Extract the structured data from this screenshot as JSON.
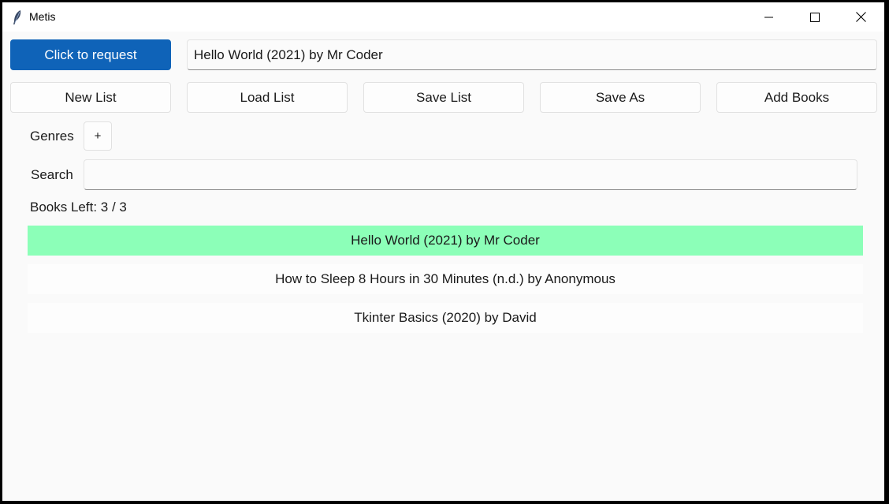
{
  "window": {
    "title": "Metis"
  },
  "titlebar": {
    "minimize_icon": "minimize-icon",
    "maximize_icon": "maximize-icon",
    "close_icon": "close-icon",
    "app_icon": "feather-icon"
  },
  "request": {
    "button_label": "Click to request",
    "field_value": "Hello World (2021) by Mr Coder"
  },
  "toolbar": {
    "buttons": [
      "New List",
      "Load List",
      "Save List",
      "Save As",
      "Add Books"
    ]
  },
  "genres": {
    "label": "Genres",
    "add_label": "+"
  },
  "search": {
    "label": "Search",
    "value": ""
  },
  "status": {
    "books_left": "Books Left: 3 / 3"
  },
  "books": [
    {
      "title": "Hello World (2021) by Mr Coder",
      "selected": true
    },
    {
      "title": "How to Sleep 8 Hours in 30 Minutes (n.d.) by Anonymous",
      "selected": false
    },
    {
      "title": "Tkinter Basics (2020) by David",
      "selected": false
    }
  ],
  "colors": {
    "accent": "#0f63b8",
    "selected_row": "#8cffb8",
    "background": "#fafafa"
  }
}
